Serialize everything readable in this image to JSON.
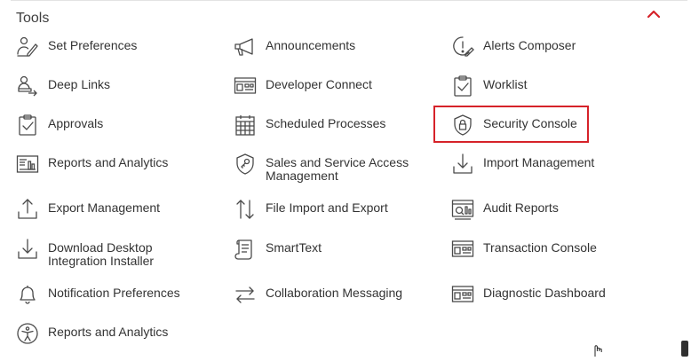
{
  "section": {
    "title": "Tools"
  },
  "colors": {
    "accent": "#d62229",
    "icon": "#4a4a4a",
    "text": "#333333"
  },
  "tools": [
    {
      "label": "Set Preferences",
      "icon": "preferences-icon"
    },
    {
      "label": "Announcements",
      "icon": "megaphone-icon"
    },
    {
      "label": "Alerts Composer",
      "icon": "alert-icon"
    },
    {
      "label": "Deep Links",
      "icon": "deep-links-icon"
    },
    {
      "label": "Developer Connect",
      "icon": "developer-connect-icon"
    },
    {
      "label": "Worklist",
      "icon": "worklist-icon"
    },
    {
      "label": "Approvals",
      "icon": "approvals-icon"
    },
    {
      "label": "Scheduled Processes",
      "icon": "calendar-icon"
    },
    {
      "label": "Security Console",
      "icon": "shield-lock-icon"
    },
    {
      "label": "Reports and Analytics",
      "icon": "reports-icon"
    },
    {
      "label": "Sales and Service Access Management",
      "icon": "shield-key-icon"
    },
    {
      "label": "Import Management",
      "icon": "import-icon"
    },
    {
      "label": "Export Management",
      "icon": "export-icon"
    },
    {
      "label": "File Import and Export",
      "icon": "file-transfer-icon"
    },
    {
      "label": "Audit Reports",
      "icon": "audit-icon"
    },
    {
      "label": "Download Desktop Integration Installer",
      "icon": "download-icon"
    },
    {
      "label": "SmartText",
      "icon": "scroll-text-icon"
    },
    {
      "label": "Transaction Console",
      "icon": "console-icon"
    },
    {
      "label": "Notification Preferences",
      "icon": "bell-icon"
    },
    {
      "label": "Collaboration Messaging",
      "icon": "arrows-exchange-icon"
    },
    {
      "label": "Diagnostic Dashboard",
      "icon": "dashboard-icon"
    },
    {
      "label": "Reports and Analytics",
      "icon": "accessibility-icon"
    }
  ]
}
